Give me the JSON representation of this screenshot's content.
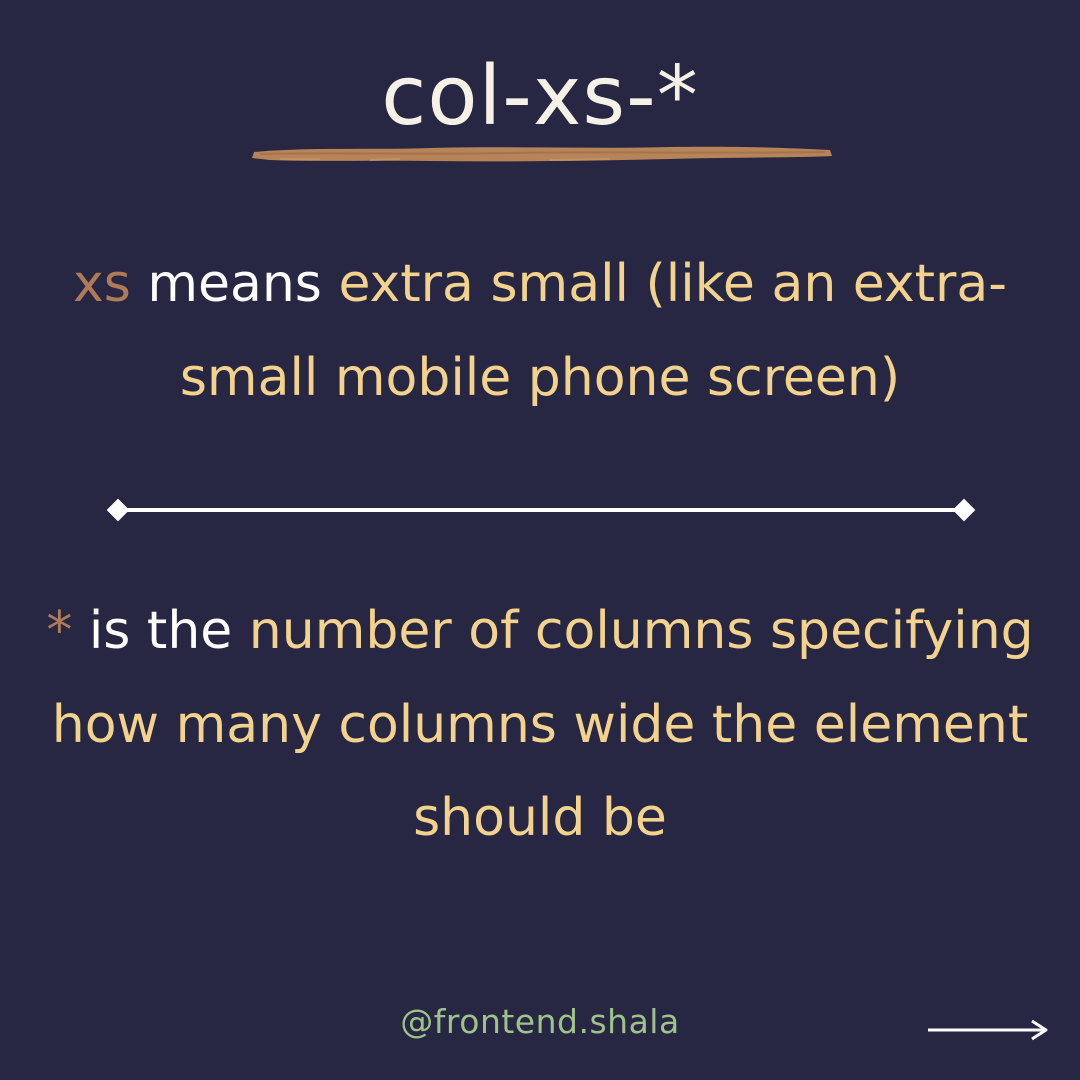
{
  "title": "col-xs-*",
  "intro": {
    "part1": "xs",
    "part2": " means ",
    "part3": "extra small (like an extra-small mobile phone screen)"
  },
  "detail": {
    "part1": "*",
    "part2": " is the ",
    "part3": "number of columns specifying how many columns wide the element should be"
  },
  "footer": {
    "handle": "@frontend.shala"
  },
  "colors": {
    "background": "#272744",
    "accent_gold": "#f2d28c",
    "accent_brown": "#b07a58",
    "white": "#ffffff",
    "handle_green": "#9ec28a"
  },
  "icons": {
    "divider": "diamond-ended-divider-line",
    "next": "right-arrow-icon"
  }
}
